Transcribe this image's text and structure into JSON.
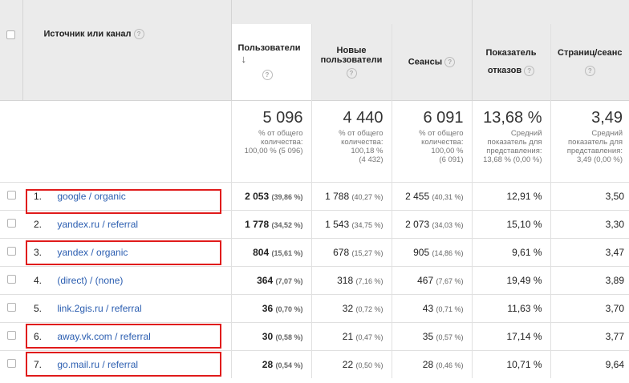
{
  "header": {
    "source_col": "Источник или канал",
    "users": "Пользователи",
    "new_users": [
      "Новые",
      "пользователи"
    ],
    "sessions": "Сеансы",
    "bounce": [
      "Показатель",
      "отказов"
    ],
    "pages": "Страниц/сеанс",
    "help": "?",
    "sort_arrow": "↓"
  },
  "totals": {
    "users": {
      "value": "5 096",
      "sub": [
        "% от общего",
        "количества:",
        "100,00 % (5 096)"
      ]
    },
    "new_users": {
      "value": "4 440",
      "sub": [
        "% от общего",
        "количества:",
        "100,18 %",
        "(4 432)"
      ]
    },
    "sessions": {
      "value": "6 091",
      "sub": [
        "% от общего",
        "количества:",
        "100,00 %",
        "(6 091)"
      ]
    },
    "bounce": {
      "value": "13,68 %",
      "sub": [
        "Средний",
        "показатель для",
        "представления:",
        "13,68 % (0,00 %)"
      ]
    },
    "pages": {
      "value": "3,49",
      "sub": [
        "Средний",
        "показатель для",
        "представления:",
        "3,49 (0,00 %)"
      ]
    }
  },
  "rows": [
    {
      "n": "1.",
      "src": "google / organic",
      "users": "2 053",
      "users_pct": "(39,86 %)",
      "new": "1 788",
      "new_pct": "(40,27 %)",
      "sess": "2 455",
      "sess_pct": "(40,31 %)",
      "bounce": "12,91 %",
      "pages": "3,50"
    },
    {
      "n": "2.",
      "src": "yandex.ru / referral",
      "users": "1 778",
      "users_pct": "(34,52 %)",
      "new": "1 543",
      "new_pct": "(34,75 %)",
      "sess": "2 073",
      "sess_pct": "(34,03 %)",
      "bounce": "15,10 %",
      "pages": "3,30"
    },
    {
      "n": "3.",
      "src": "yandex / organic",
      "users": "804",
      "users_pct": "(15,61 %)",
      "new": "678",
      "new_pct": "(15,27 %)",
      "sess": "905",
      "sess_pct": "(14,86 %)",
      "bounce": "9,61 %",
      "pages": "3,47"
    },
    {
      "n": "4.",
      "src": "(direct) / (none)",
      "users": "364",
      "users_pct": "(7,07 %)",
      "new": "318",
      "new_pct": "(7,16 %)",
      "sess": "467",
      "sess_pct": "(7,67 %)",
      "bounce": "19,49 %",
      "pages": "3,89"
    },
    {
      "n": "5.",
      "src": "link.2gis.ru / referral",
      "users": "36",
      "users_pct": "(0,70 %)",
      "new": "32",
      "new_pct": "(0,72 %)",
      "sess": "43",
      "sess_pct": "(0,71 %)",
      "bounce": "11,63 %",
      "pages": "3,70"
    },
    {
      "n": "6.",
      "src": "away.vk.com / referral",
      "users": "30",
      "users_pct": "(0,58 %)",
      "new": "21",
      "new_pct": "(0,47 %)",
      "sess": "35",
      "sess_pct": "(0,57 %)",
      "bounce": "17,14 %",
      "pages": "3,77"
    },
    {
      "n": "7.",
      "src": "go.mail.ru / referral",
      "users": "28",
      "users_pct": "(0,54 %)",
      "new": "22",
      "new_pct": "(0,50 %)",
      "sess": "28",
      "sess_pct": "(0,46 %)",
      "bounce": "10,71 %",
      "pages": "9,64"
    }
  ],
  "colors": {
    "highlight": "#e01b1b",
    "link": "#2a5db0",
    "header_bg": "#ebebeb"
  }
}
